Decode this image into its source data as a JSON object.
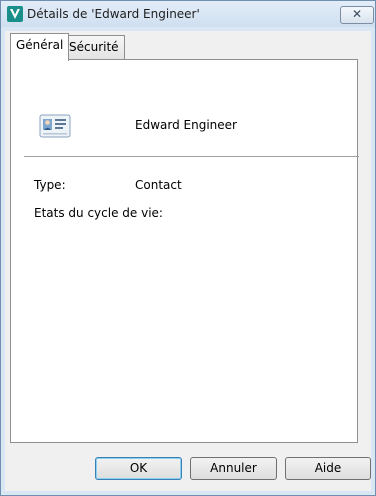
{
  "window": {
    "title": "Détails de 'Edward Engineer'",
    "close_symbol": "✕",
    "app_icon": "app-logo-icon"
  },
  "tabs": [
    {
      "label": "Général",
      "active": true
    },
    {
      "label": "Sécurité",
      "active": false
    }
  ],
  "general": {
    "contact_icon": "contact-card-icon",
    "name": "Edward Engineer",
    "type_label": "Type:",
    "type_value": "Contact",
    "lifecycle_label": "Etats du cycle de vie:"
  },
  "buttons": {
    "ok": "OK",
    "cancel": "Annuler",
    "help": "Aide"
  }
}
